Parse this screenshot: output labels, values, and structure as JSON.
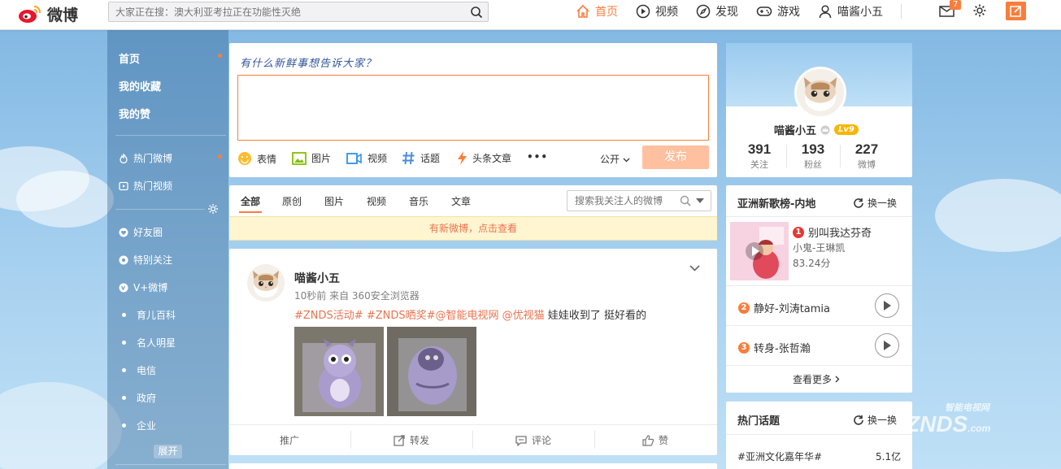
{
  "logo": {
    "text": "微博"
  },
  "search": {
    "placeholder": "大家正在搜：澳大利亚考拉正在功能性灭绝"
  },
  "nav": {
    "items": [
      {
        "label": "首页"
      },
      {
        "label": "视频"
      },
      {
        "label": "发现"
      },
      {
        "label": "游戏"
      },
      {
        "label": "喵酱小五"
      }
    ],
    "message_badge": "7"
  },
  "left_nav": {
    "primary": [
      "首页",
      "我的收藏",
      "我的赞"
    ],
    "secondary": [
      "热门微博",
      "热门视频"
    ],
    "groups": [
      "好友圈",
      "特别关注",
      "V+微博",
      "育儿百科",
      "名人明星",
      "电信",
      "政府",
      "企业"
    ],
    "expand": "展开"
  },
  "publisher": {
    "prompt": "有什么新鲜事想告诉大家？",
    "tools": [
      "表情",
      "图片",
      "视频",
      "话题",
      "头条文章"
    ],
    "more": "•••",
    "visibility": "公开",
    "submit": "发布"
  },
  "feed_tabs": {
    "items": [
      "全部",
      "原创",
      "图片",
      "视频",
      "音乐",
      "文章"
    ],
    "search_placeholder": "搜索我关注人的微博",
    "notice": "有新微博，点击查看"
  },
  "post": {
    "author": "喵酱小五",
    "meta": "10秒前 来自 360安全浏览器",
    "tags": [
      "#ZNDS活动#",
      "#ZNDS晒奖#",
      "@智能电视网",
      "@优视猫"
    ],
    "text": "娃娃收到了 挺好看的",
    "actions": [
      "推广",
      "转发",
      "评论",
      "赞"
    ]
  },
  "profile": {
    "name": "喵酱小五",
    "level": "Lv9",
    "stats": [
      {
        "value": "391",
        "label": "关注"
      },
      {
        "value": "193",
        "label": "粉丝"
      },
      {
        "value": "227",
        "label": "微博"
      }
    ]
  },
  "music": {
    "title": "亚洲新歌榜-内地",
    "refresh": "换一换",
    "songs": [
      {
        "rank": "1",
        "title": "别叫我达芬奇",
        "artist": "小鬼-王琳凯",
        "score": "83.24分"
      },
      {
        "rank": "2",
        "title": "静好-刘涛tamia"
      },
      {
        "rank": "3",
        "title": "转身-张哲瀚"
      }
    ],
    "more": "查看更多"
  },
  "topics": {
    "title": "热门话题",
    "refresh": "换一换",
    "items": [
      {
        "name": "#亚洲文化嘉年华#",
        "count": "5.1亿"
      }
    ]
  },
  "watermark": {
    "line1": "智能电视网",
    "line2": "ZNDS",
    "line3": ".com"
  },
  "colors": {
    "accent": "#fa7d3c",
    "link": "#eb7350",
    "notice_bg": "#fff5d1"
  }
}
